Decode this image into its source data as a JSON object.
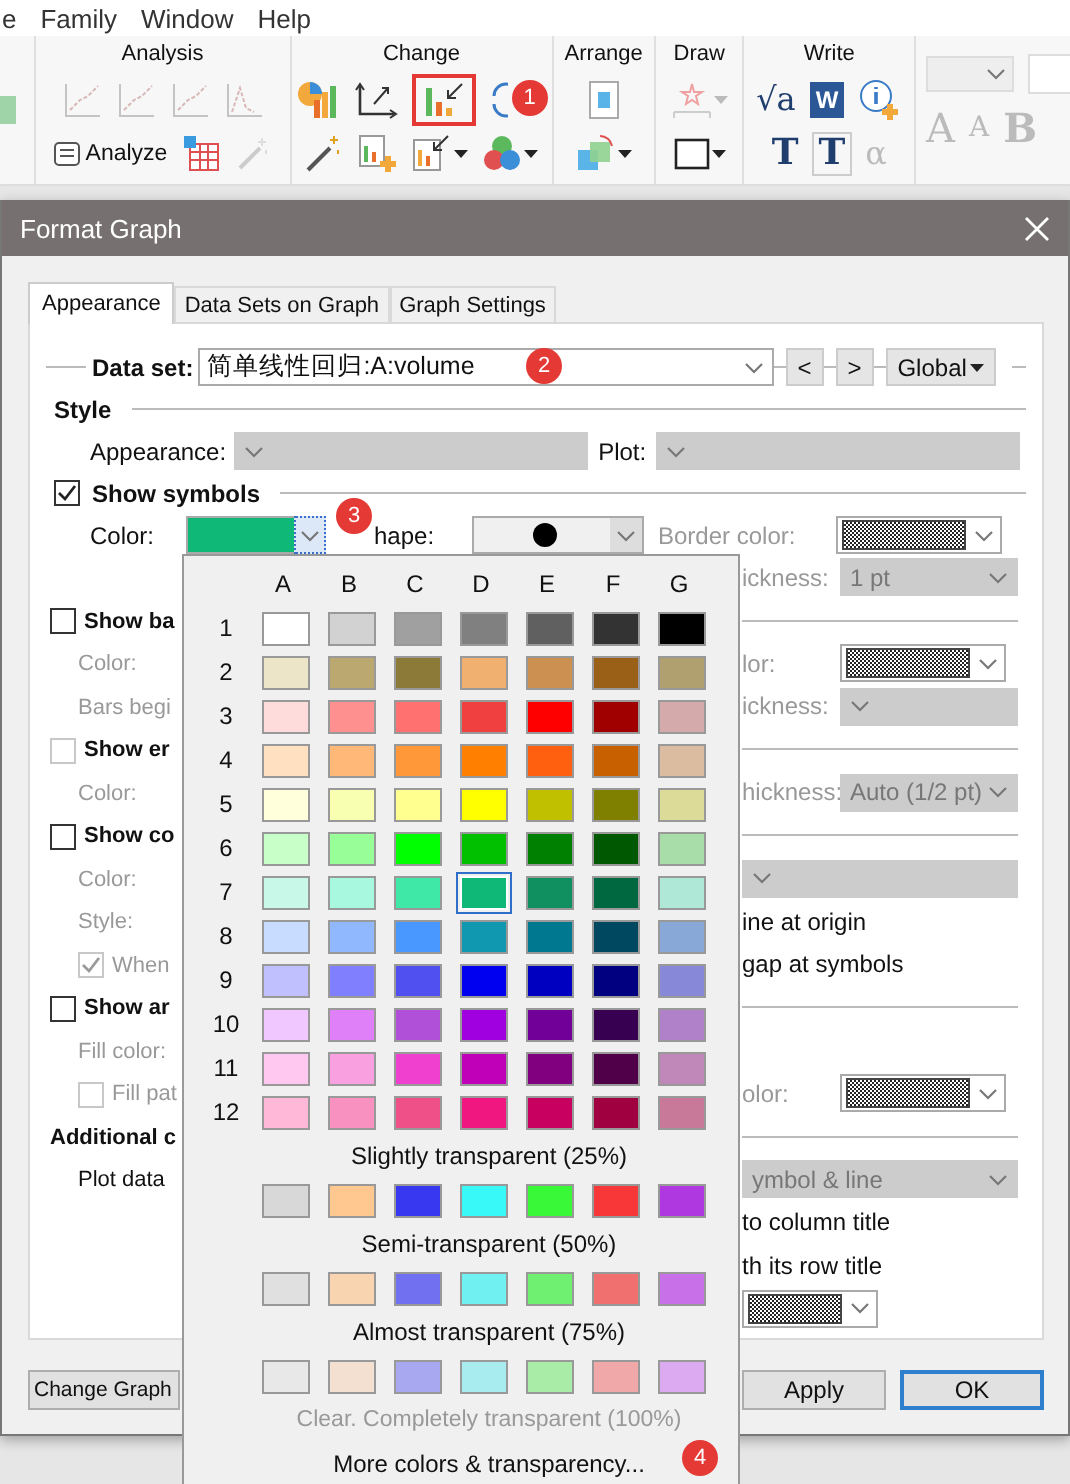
{
  "menu": [
    "e",
    "Family",
    "Window",
    "Help"
  ],
  "ribbon": {
    "groups": [
      {
        "title": "Analysis",
        "kind": "analysis"
      },
      {
        "title": "Change",
        "kind": "change"
      },
      {
        "title": "Arrange",
        "kind": "arrange"
      },
      {
        "title": "Draw",
        "kind": "draw"
      },
      {
        "title": "Write",
        "kind": "write"
      }
    ],
    "analyze_button": "Analyze",
    "badge": "1",
    "write_tools": [
      "√a",
      "W",
      "T",
      "T",
      "α"
    ],
    "font_tools": [
      "A",
      "A",
      "B"
    ]
  },
  "dialog": {
    "title": "Format Graph"
  },
  "tabs": [
    {
      "label": "Appearance",
      "selected": true
    },
    {
      "label": "Data Sets on Graph",
      "selected": false
    },
    {
      "label": "Graph Settings",
      "selected": false
    }
  ],
  "data_set": {
    "label": "Data set:",
    "value": "简单线性回归:A:volume",
    "badge": "2",
    "prev": "<",
    "next": ">",
    "scope": "Global"
  },
  "style": {
    "heading": "Style",
    "appearance_label": "Appearance:",
    "plot_label": "Plot:"
  },
  "symbols": {
    "label": "Show symbols",
    "checked": true,
    "color_label": "Color:",
    "color": "#10b878",
    "expanded": true,
    "badge": "3",
    "shape_label": "hape:",
    "border_color_label": "Border color:"
  },
  "left_rows": [
    {
      "kind": "check",
      "label": "Show ba",
      "checked": false,
      "disabled": false
    },
    {
      "kind": "label",
      "label": "Color:"
    },
    {
      "kind": "label",
      "label": "Bars begi"
    },
    {
      "kind": "check",
      "label": "Show er",
      "checked": false,
      "disabled": true
    },
    {
      "kind": "label",
      "label": "Color:"
    },
    {
      "kind": "check",
      "label": "Show co",
      "checked": false,
      "disabled": false
    },
    {
      "kind": "label",
      "label": "Color:"
    },
    {
      "kind": "label",
      "label": "Style:"
    },
    {
      "kind": "subcheck",
      "label": "When",
      "checked": true
    },
    {
      "kind": "check",
      "label": "Show ar",
      "checked": false,
      "disabled": false
    },
    {
      "kind": "label",
      "label": "Fill color:"
    },
    {
      "kind": "subcheck",
      "label": "Fill pat",
      "checked": false
    },
    {
      "kind": "heading",
      "label": "Additional c"
    },
    {
      "kind": "text",
      "label": "Plot data"
    }
  ],
  "right_rows": [
    {
      "kind": "select",
      "label": "ickness:",
      "value": "1 pt"
    },
    {
      "kind": "divider"
    },
    {
      "kind": "hatched",
      "label": "lor:"
    },
    {
      "kind": "select",
      "label": "ickness:"
    },
    {
      "kind": "divider"
    },
    {
      "kind": "select",
      "label": "hickness:",
      "value": "Auto (1/2 pt)"
    },
    {
      "kind": "divider"
    },
    {
      "kind": "select"
    },
    {
      "kind": "text",
      "label": "ine at origin"
    },
    {
      "kind": "text",
      "label": "gap at symbols"
    },
    {
      "kind": "divider"
    },
    {
      "kind": "blank"
    },
    {
      "kind": "hatched",
      "label": "olor:"
    },
    {
      "kind": "divider"
    },
    {
      "kind": "select",
      "value": "ymbol & line"
    },
    {
      "kind": "text",
      "label": "to column title"
    },
    {
      "kind": "text",
      "label": "th its row title"
    },
    {
      "kind": "hatched"
    }
  ],
  "palette": {
    "columns": [
      "A",
      "B",
      "C",
      "D",
      "E",
      "F",
      "G"
    ],
    "rows": [
      {
        "label": "1",
        "swatches": [
          {
            "color": "#ffffff",
            "selected": false
          },
          {
            "color": "#d2d2d2",
            "selected": false
          },
          {
            "color": "#a0a0a0",
            "selected": false
          },
          {
            "color": "#808080",
            "selected": false
          },
          {
            "color": "#606060",
            "selected": false
          },
          {
            "color": "#333333",
            "selected": false
          },
          {
            "color": "#000000",
            "selected": false
          }
        ]
      },
      {
        "label": "2",
        "swatches": [
          {
            "color": "#ece5c8",
            "selected": false
          },
          {
            "color": "#bba870",
            "selected": false
          },
          {
            "color": "#8c7a38",
            "selected": false
          },
          {
            "color": "#f0b070",
            "selected": false
          },
          {
            "color": "#cc9050",
            "selected": false
          },
          {
            "color": "#9a6018",
            "selected": false
          },
          {
            "color": "#b0a070",
            "selected": false
          }
        ]
      },
      {
        "label": "3",
        "swatches": [
          {
            "color": "#ffdcdc",
            "selected": false
          },
          {
            "color": "#ff9090",
            "selected": false
          },
          {
            "color": "#ff7070",
            "selected": false
          },
          {
            "color": "#f04040",
            "selected": false
          },
          {
            "color": "#ff0000",
            "selected": false
          },
          {
            "color": "#a00000",
            "selected": false
          },
          {
            "color": "#d4aaaa",
            "selected": false
          }
        ]
      },
      {
        "label": "4",
        "swatches": [
          {
            "color": "#ffe0c0",
            "selected": false
          },
          {
            "color": "#ffb878",
            "selected": false
          },
          {
            "color": "#ff9838",
            "selected": false
          },
          {
            "color": "#ff8000",
            "selected": false
          },
          {
            "color": "#ff6010",
            "selected": false
          },
          {
            "color": "#c86000",
            "selected": false
          },
          {
            "color": "#dcbca0",
            "selected": false
          }
        ]
      },
      {
        "label": "5",
        "swatches": [
          {
            "color": "#ffffdc",
            "selected": false
          },
          {
            "color": "#f8ffb0",
            "selected": false
          },
          {
            "color": "#ffff90",
            "selected": false
          },
          {
            "color": "#ffff00",
            "selected": false
          },
          {
            "color": "#c0c000",
            "selected": false
          },
          {
            "color": "#808000",
            "selected": false
          },
          {
            "color": "#dcdc98",
            "selected": false
          }
        ]
      },
      {
        "label": "6",
        "swatches": [
          {
            "color": "#c8ffc8",
            "selected": false
          },
          {
            "color": "#98ff98",
            "selected": false
          },
          {
            "color": "#00ff00",
            "selected": false
          },
          {
            "color": "#00c000",
            "selected": false
          },
          {
            "color": "#008000",
            "selected": false
          },
          {
            "color": "#005800",
            "selected": false
          },
          {
            "color": "#a8dca8",
            "selected": false
          }
        ]
      },
      {
        "label": "7",
        "swatches": [
          {
            "color": "#c8f8e8",
            "selected": false
          },
          {
            "color": "#a8f8e0",
            "selected": false
          },
          {
            "color": "#40e8a8",
            "selected": false
          },
          {
            "color": "#10b878",
            "selected": true
          },
          {
            "color": "#109060",
            "selected": false
          },
          {
            "color": "#006840",
            "selected": false
          },
          {
            "color": "#b0e8d8",
            "selected": false
          }
        ]
      },
      {
        "label": "8",
        "swatches": [
          {
            "color": "#c8dcff",
            "selected": false
          },
          {
            "color": "#90b8ff",
            "selected": false
          },
          {
            "color": "#4898ff",
            "selected": false
          },
          {
            "color": "#1098b0",
            "selected": false
          },
          {
            "color": "#007890",
            "selected": false
          },
          {
            "color": "#004860",
            "selected": false
          },
          {
            "color": "#88a8d8",
            "selected": false
          }
        ]
      },
      {
        "label": "9",
        "swatches": [
          {
            "color": "#c0c0ff",
            "selected": false
          },
          {
            "color": "#8080ff",
            "selected": false
          },
          {
            "color": "#5050f0",
            "selected": false
          },
          {
            "color": "#0000f0",
            "selected": false
          },
          {
            "color": "#0000c0",
            "selected": false
          },
          {
            "color": "#000080",
            "selected": false
          },
          {
            "color": "#8888d8",
            "selected": false
          }
        ]
      },
      {
        "label": "10",
        "swatches": [
          {
            "color": "#f0c8ff",
            "selected": false
          },
          {
            "color": "#e080f8",
            "selected": false
          },
          {
            "color": "#b050d8",
            "selected": false
          },
          {
            "color": "#a000e0",
            "selected": false
          },
          {
            "color": "#700098",
            "selected": false
          },
          {
            "color": "#380050",
            "selected": false
          },
          {
            "color": "#b080c8",
            "selected": false
          }
        ]
      },
      {
        "label": "11",
        "swatches": [
          {
            "color": "#ffc8f0",
            "selected": false
          },
          {
            "color": "#f8a0e0",
            "selected": false
          },
          {
            "color": "#f040d0",
            "selected": false
          },
          {
            "color": "#c000b8",
            "selected": false
          },
          {
            "color": "#800080",
            "selected": false
          },
          {
            "color": "#500048",
            "selected": false
          },
          {
            "color": "#c088b8",
            "selected": false
          }
        ]
      },
      {
        "label": "12",
        "swatches": [
          {
            "color": "#ffb8d8",
            "selected": false
          },
          {
            "color": "#f890c0",
            "selected": false
          },
          {
            "color": "#f05088",
            "selected": false
          },
          {
            "color": "#f01880",
            "selected": false
          },
          {
            "color": "#c80060",
            "selected": false
          },
          {
            "color": "#a00040",
            "selected": false
          },
          {
            "color": "#c87898",
            "selected": false
          }
        ]
      }
    ],
    "transparency": [
      {
        "label": "Slightly transparent (25%)",
        "swatches": [
          {
            "color": "#d8d8d8",
            "selected": false
          },
          {
            "color": "#ffc890",
            "selected": false
          },
          {
            "color": "#3838f0",
            "selected": false
          },
          {
            "color": "#38f8f8",
            "selected": false
          },
          {
            "color": "#38f838",
            "selected": false
          },
          {
            "color": "#f83838",
            "selected": false
          },
          {
            "color": "#b038e0",
            "selected": false
          }
        ]
      },
      {
        "label": "Semi-transparent (50%)",
        "swatches": [
          {
            "color": "#e0e0e0",
            "selected": false
          },
          {
            "color": "#f8d4b0",
            "selected": false
          },
          {
            "color": "#7070f0",
            "selected": false
          },
          {
            "color": "#70f0f0",
            "selected": false
          },
          {
            "color": "#70f070",
            "selected": false
          },
          {
            "color": "#f07070",
            "selected": false
          },
          {
            "color": "#c870e8",
            "selected": false
          }
        ]
      },
      {
        "label": "Almost transparent (75%)",
        "swatches": [
          {
            "color": "#e8e8e8",
            "selected": false
          },
          {
            "color": "#f4e0d0",
            "selected": false
          },
          {
            "color": "#a8a8f0",
            "selected": false
          },
          {
            "color": "#a8ecf0",
            "selected": false
          },
          {
            "color": "#a8eca8",
            "selected": false
          },
          {
            "color": "#f0a8a8",
            "selected": false
          },
          {
            "color": "#dcaaf0",
            "selected": false
          }
        ]
      }
    ],
    "clear_label": "Clear. Completely transparent (100%)",
    "more_label": "More colors & transparency...",
    "badge": "4"
  },
  "buttons": {
    "change_graph": "Change Graph",
    "apply": "Apply",
    "ok": "OK"
  }
}
